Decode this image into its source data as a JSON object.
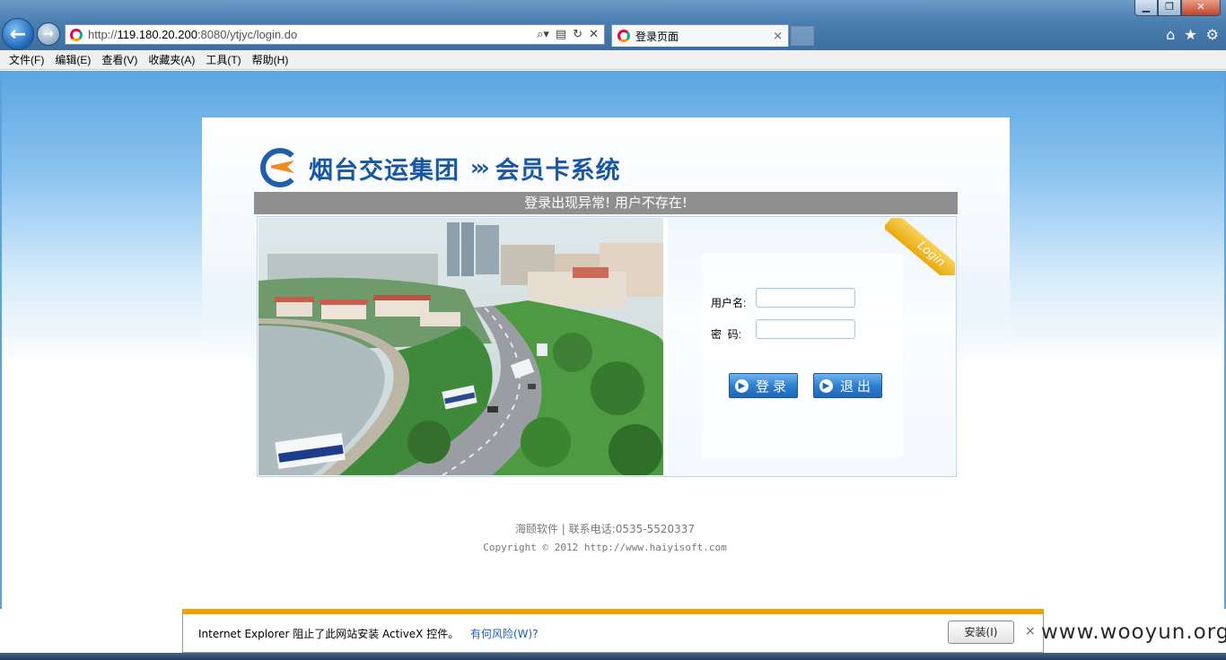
{
  "browser": {
    "url_prefix": "http://",
    "url_host": "119.180.20.200",
    "url_rest": ":8080/ytjyc/login.do",
    "tab_title": "登录页面",
    "window_buttons": {
      "minimize": "▁",
      "maximize": "❐",
      "close": "✕"
    },
    "icons": [
      "back-arrow-icon",
      "forward-arrow-icon",
      "search-icon",
      "compat-view-icon",
      "refresh-icon",
      "stop-icon",
      "home-icon",
      "favorites-star-icon",
      "tools-gear-icon"
    ],
    "menu": [
      "文件(F)",
      "编辑(E)",
      "查看(V)",
      "收藏夹(A)",
      "工具(T)",
      "帮助(H)"
    ]
  },
  "page": {
    "brand": "烟台交运集团",
    "arrows": "›››",
    "system_name": "会员卡系统",
    "error_message": "登录出现异常! 用户不存在!",
    "ribbon": "Login",
    "username_label": "用户名:",
    "password_label": "密  码:",
    "username_value": "",
    "password_value": "",
    "login_button": "登录",
    "exit_button": "退出",
    "footer_line1": "海颐软件 | 联系电话:0535-5520337",
    "footer_line2": "Copyright © 2012 http://www.haiyisoft.com",
    "colors": {
      "brand_blue": "#1a57a3",
      "error_bar": "#8f8f8f",
      "button_blue": "#2f7fd0",
      "ribbon_gold": "#f0b321"
    }
  },
  "notification": {
    "message": "Internet Explorer 阻止了此网站安装 ActiveX 控件。",
    "link": "有何风险(W)?",
    "install_button": "安装(I)",
    "close": "×"
  },
  "watermark": "www.wooyun.org"
}
